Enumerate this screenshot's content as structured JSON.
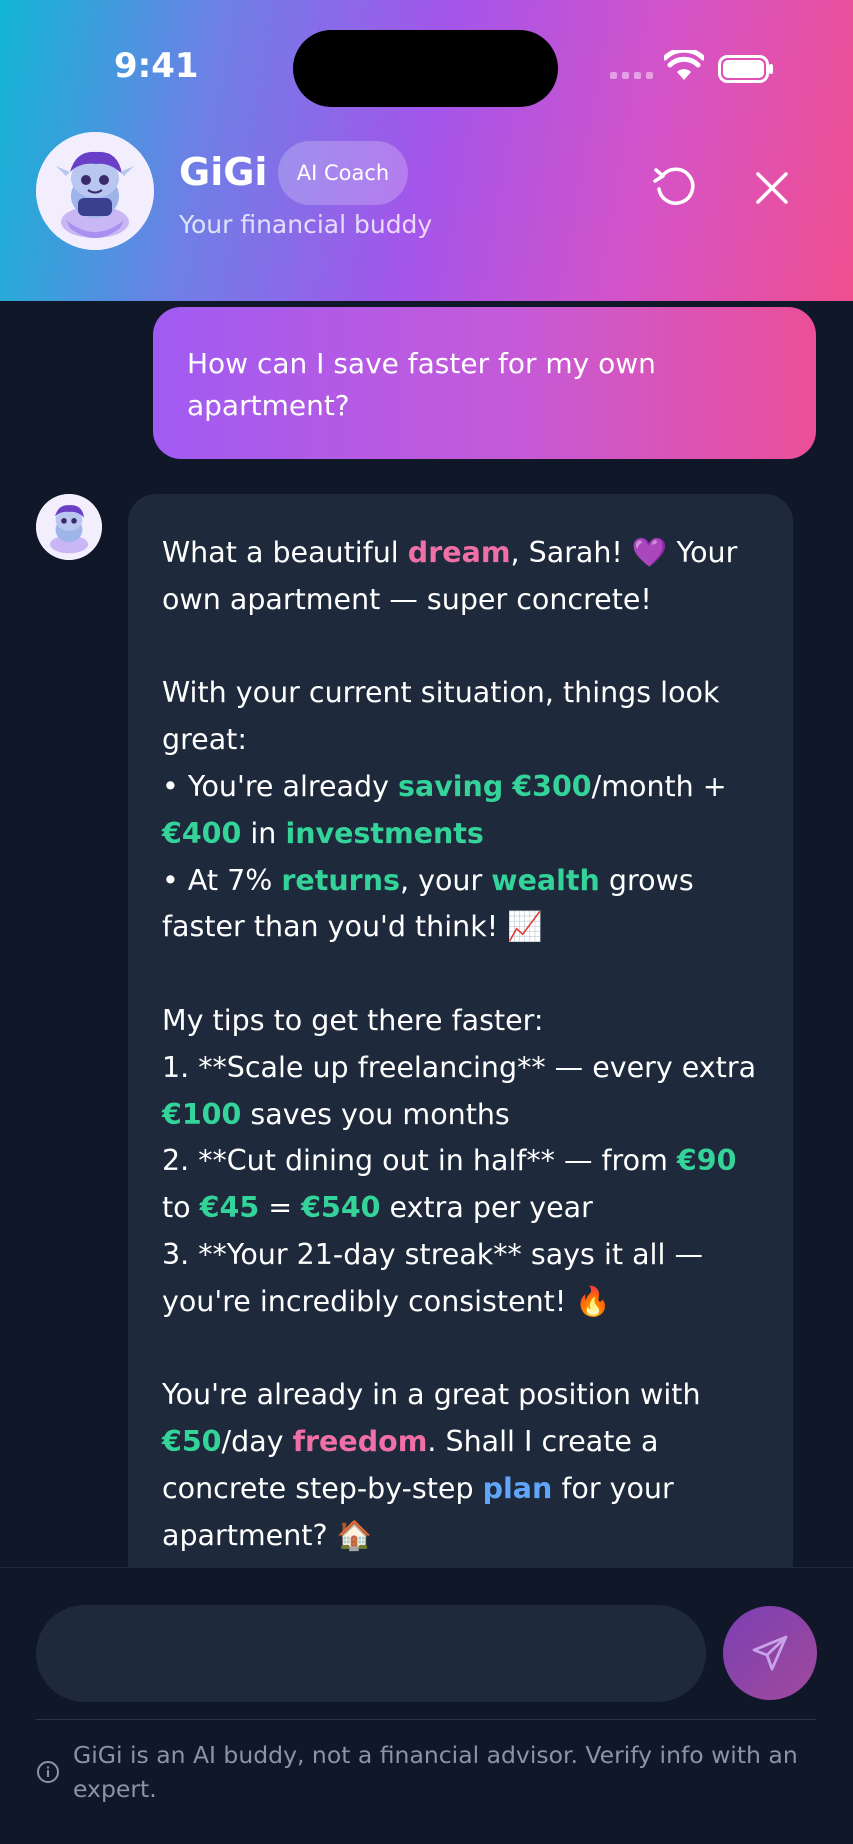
{
  "status_bar": {
    "time": "9:41"
  },
  "header": {
    "name": "GiGi",
    "badge": "AI Coach",
    "subtitle": "Your financial buddy"
  },
  "user_message": "How can I save faster for my own apartment?",
  "bot_message": {
    "l1_a": "What a beautiful ",
    "l1_dream": "dream",
    "l1_b": ", Sarah! 💜 Your own apartment — super concrete!",
    "l2": "With your current situation, things look great:",
    "l3_a": "• You're already ",
    "l3_saving": "saving",
    "l3_sp": " ",
    "l3_amount": "€300",
    "l3_b": "/month + ",
    "l3_invest_amount": "€400",
    "l3_c": " in ",
    "l3_investments": "investments",
    "l4_a": "• At 7% ",
    "l4_returns": "returns",
    "l4_b": ", your ",
    "l4_wealth": "wealth",
    "l4_c": " grows faster than you'd think! 📈",
    "l5": "My tips to get there faster:",
    "l6_a": "1. **Scale up freelancing** — every extra ",
    "l6_amount": "€100",
    "l6_b": " saves you months",
    "l7_a": "2. **Cut dining out in half** — from ",
    "l7_from": "€90",
    "l7_b": " to ",
    "l7_to": "€45",
    "l7_c": " = ",
    "l7_total": "€540",
    "l7_d": " extra per year",
    "l8": "3. **Your 21-day streak** says it all — you're incredibly consistent! 🔥",
    "l9_a": "You're already in a great position with ",
    "l9_amount": "€50",
    "l9_b": "/day ",
    "l9_freedom": "freedom",
    "l9_c": ". Shall I create a concrete step-by-step ",
    "l9_plan": "plan",
    "l9_d": " for your apartment? 🏠"
  },
  "composer": {
    "input_value": "",
    "disclaimer": "GiGi is an AI buddy, not a financial advisor. Verify info with an expert."
  },
  "colors": {
    "accent_pink": "#f06fa7",
    "accent_green": "#34d399",
    "accent_blue": "#60a5fa",
    "background": "#0f1729",
    "bubble": "#1e293b"
  },
  "icons": [
    "wifi-icon",
    "battery-icon",
    "reset-icon",
    "close-icon",
    "send-icon",
    "info-icon"
  ]
}
